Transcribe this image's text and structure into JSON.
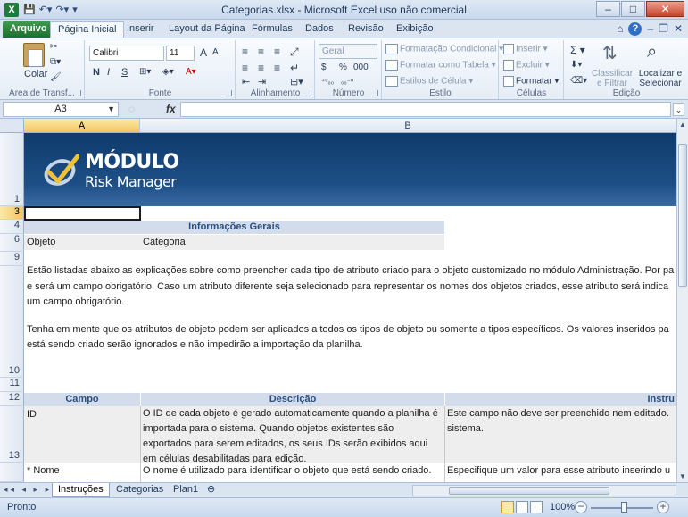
{
  "window": {
    "title": "Categorias.xlsx - Microsoft Excel uso não comercial",
    "app_icon": "X",
    "buttons": {
      "minimize": "–",
      "maximize": "□",
      "close": "✕"
    }
  },
  "ribbon_tabs": {
    "file": "Arquivo",
    "items": [
      "Página Inicial",
      "Inserir",
      "Layout da Página",
      "Fórmulas",
      "Dados",
      "Revisão",
      "Exibição"
    ]
  },
  "ribbon": {
    "clipboard": {
      "label": "Área de Transf...",
      "paste": "Colar"
    },
    "font": {
      "label": "Fonte",
      "name": "Calibri",
      "size": "11",
      "bold": "N",
      "italic": "I",
      "underline": "S",
      "grow": "A",
      "shrink": "A"
    },
    "alignment": {
      "label": "Alinhamento"
    },
    "number": {
      "label": "Número",
      "format": "Geral",
      "currency": "$",
      "percent": "%",
      "thousands": "000"
    },
    "styles": {
      "label": "Estilo",
      "conditional": "Formatação Condicional",
      "table": "Formatar como Tabela",
      "cell": "Estilos de Célula"
    },
    "cells": {
      "label": "Células",
      "insert": "Inserir",
      "delete": "Excluir",
      "format": "Formatar"
    },
    "editing": {
      "label": "Edição",
      "sum": "Σ",
      "sort": "Classificar e Filtrar",
      "find": "Localizar e Selecionar"
    }
  },
  "formula_bar": {
    "name_box": "A3",
    "fx": "fx",
    "value": ""
  },
  "columns": {
    "a": "A",
    "b": "B"
  },
  "rows": [
    "1",
    "3",
    "4",
    "6",
    "9",
    "10",
    "11",
    "12",
    "13"
  ],
  "logo": {
    "line1": "MÓDULO",
    "line2": "Risk Manager"
  },
  "sheet": {
    "section_title": "Informações Gerais",
    "row6_a": "Objeto",
    "row6_b": "Categoria",
    "paragraph1_line1": "Estão listadas abaixo as explicações sobre como preencher cada tipo de atributo criado para o objeto customizado no módulo Administração. Por pa",
    "paragraph1_line2": "e será um campo obrigatório. Caso um atributo diferente seja selecionado para representar os nomes dos objetos criados, esse atributo será indica",
    "paragraph1_line3": "um campo obrigatório.",
    "paragraph2_line1": "Tenha em mente que os atributos de objeto podem ser aplicados a todos os tipos de objeto ou somente a tipos específicos. Os valores inseridos pa",
    "paragraph2_line2": "está sendo criado serão ignorados e não impedirão a importação da planilha.",
    "table_headers": {
      "campo": "Campo",
      "descricao": "Descrição",
      "instrucoes": "Instru"
    },
    "row13": {
      "campo": "ID",
      "descricao": "O ID de cada objeto é gerado automaticamente quando a planilha é importada para o sistema. Quando objetos existentes são exportados para serem editados, os seus IDs serão exibidos aqui em células desabilitadas para edição.",
      "instrucoes": "Este campo não deve ser preenchido nem editado. sistema."
    },
    "row14": {
      "campo": "* Nome",
      "descricao": "O nome é utilizado para identificar o objeto que está sendo criado.",
      "instrucoes": "Especifique um valor para esse atributo inserindo u"
    }
  },
  "sheet_tabs": [
    "Instruções",
    "Categorias",
    "Plan1"
  ],
  "status": {
    "text": "Pronto",
    "zoom": "100%"
  }
}
